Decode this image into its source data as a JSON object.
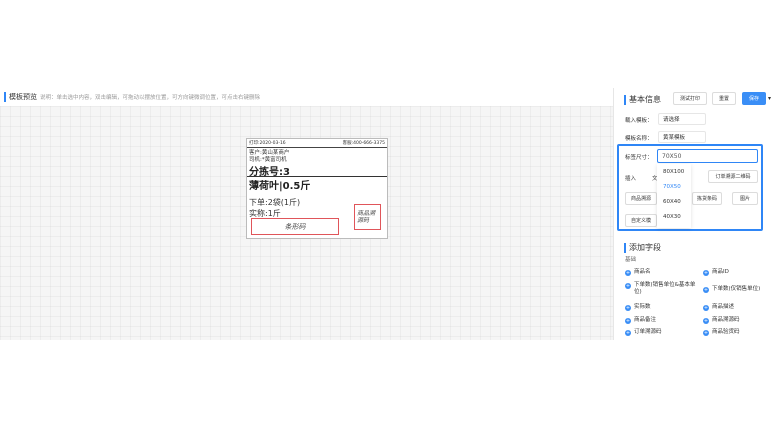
{
  "preview": {
    "title": "模板预览",
    "hint": "说明：单击选中内容，双击编辑，可拖动以摆放位置，可方向键微调位置，可点击右键删除"
  },
  "label": {
    "date": "打印:2020-03-16",
    "phone": "客服:400-666-3375",
    "customer": "客户:黄山某商户",
    "driver": "司机:*黄富司机",
    "sort_no": "分拣号:3",
    "product": "薄荷叶|0.5斤",
    "order_qty": "下单:2袋(1斤)",
    "actual_qty": "实称:1斤",
    "barcode": "条形码",
    "qrcode": "商品溯源码"
  },
  "panel": {
    "basic_title": "基本信息",
    "buttons": {
      "test_print": "测试打印",
      "reset": "重置",
      "save": "保存"
    },
    "load_template_label": "载入模板：",
    "load_template_value": "请选择",
    "template_name_label": "模板名称：",
    "template_name_value": "黄某模板",
    "label_size_label": "标签尺寸：",
    "label_size_value": "70X50",
    "size_options": [
      "80X100",
      "70X50",
      "60X40",
      "40X30"
    ],
    "selected_size": "70X50",
    "insert_label": "插入",
    "insert_text": "文",
    "btn_order_qr": "订单溯源二维码",
    "btn_product_qr": "商品溯源",
    "btn_barcode": "拣货条码",
    "btn_image": "图片",
    "btn_custom": "自定义模",
    "add_fields_title": "添加字段",
    "group_basic": "基础",
    "fields": [
      "商品名",
      "商品ID",
      "下单数(销售单位&基本单位)",
      "下单数(仅销售单位)",
      "实际数",
      "商品描述",
      "商品备注",
      "商品溯源码",
      "订单溯源码",
      "商品验货码"
    ]
  },
  "colors": {
    "accent": "#2f86f6",
    "primary_button": "#3a8ef6",
    "label_box_border": "#e0555a"
  },
  "icons": {
    "save_dropdown": "caret-down-icon",
    "add_field": "plus-circle-icon"
  }
}
